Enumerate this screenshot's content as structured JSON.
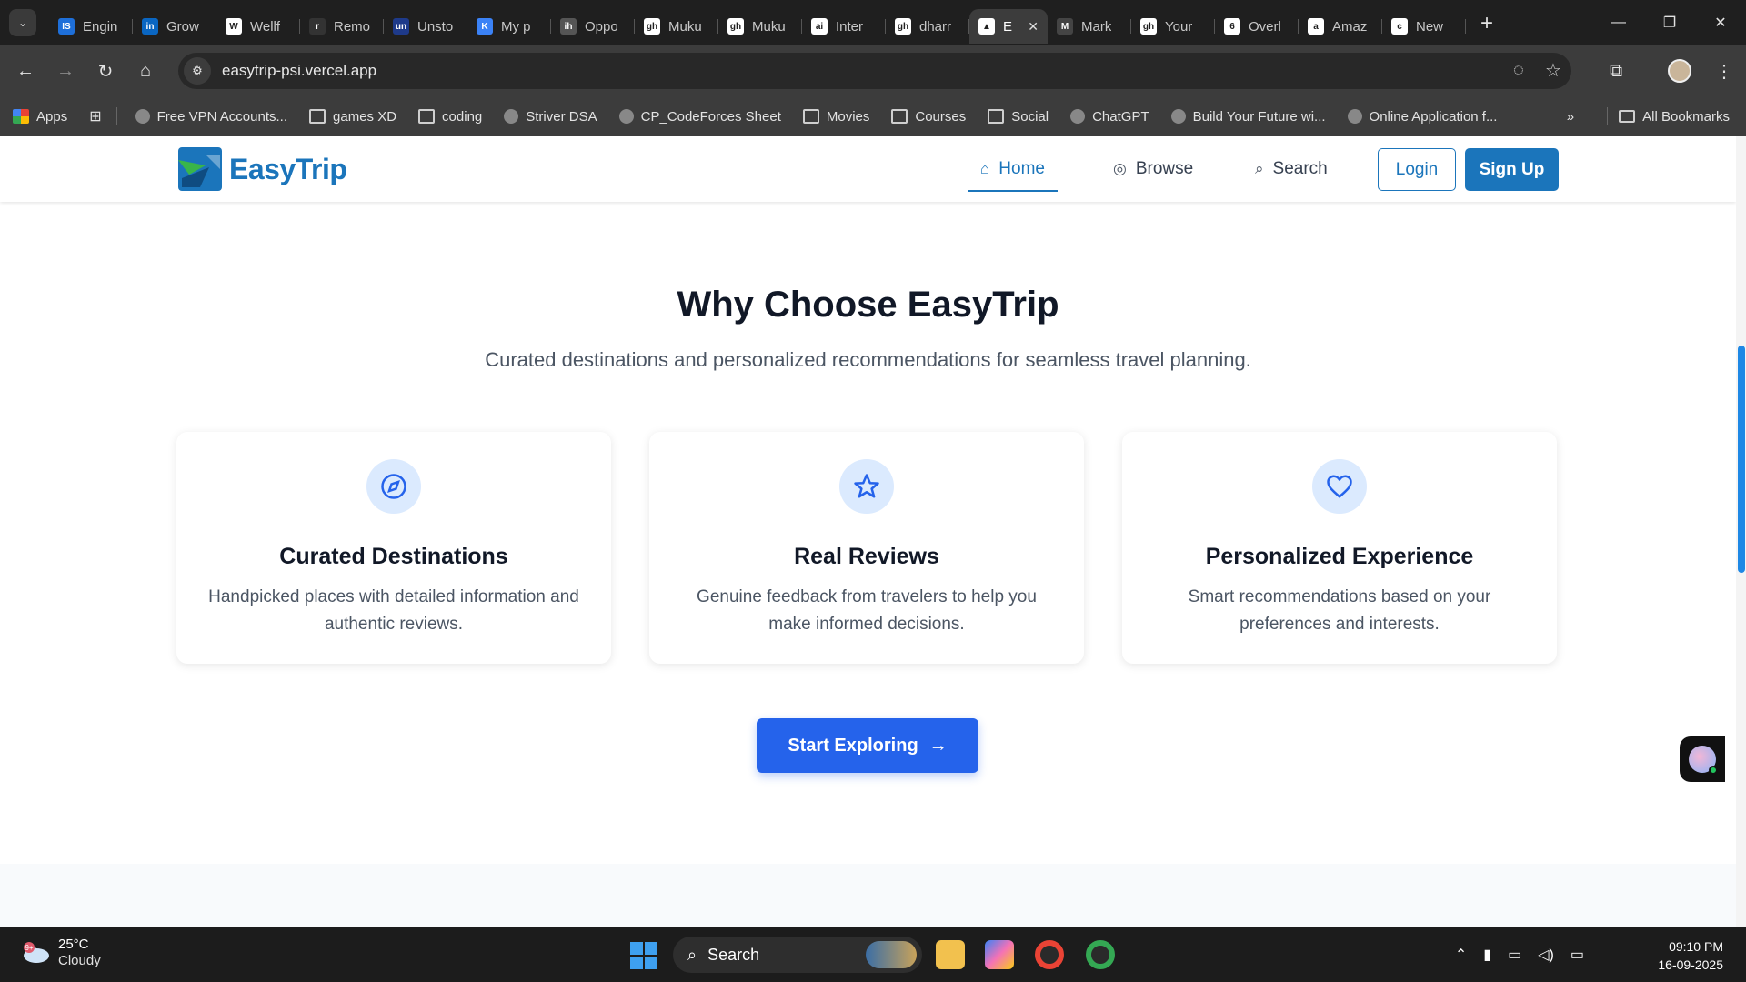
{
  "browser": {
    "tabs": [
      {
        "label": "Engin",
        "color": "#1e6fd9",
        "glyph": "IS"
      },
      {
        "label": "Grow",
        "color": "#0a66c2",
        "glyph": "in"
      },
      {
        "label": "Wellf",
        "color": "#ffffff",
        "glyph": "W"
      },
      {
        "label": "Remo",
        "color": "#333333",
        "glyph": "r"
      },
      {
        "label": "Unsto",
        "color": "#1e3a8a",
        "glyph": "un"
      },
      {
        "label": "My p",
        "color": "#3b82f6",
        "glyph": "K"
      },
      {
        "label": "Oppo",
        "color": "#555555",
        "glyph": "ih"
      },
      {
        "label": "Muku",
        "color": "#ffffff",
        "glyph": "gh"
      },
      {
        "label": "Muku",
        "color": "#ffffff",
        "glyph": "gh"
      },
      {
        "label": "Inter",
        "color": "#ffffff",
        "glyph": "ai"
      },
      {
        "label": "dharr",
        "color": "#ffffff",
        "glyph": "gh"
      },
      {
        "label": "E",
        "color": "#ffffff",
        "glyph": "▲",
        "active": true
      },
      {
        "label": "Mark",
        "color": "#444444",
        "glyph": "M"
      },
      {
        "label": "Your",
        "color": "#ffffff",
        "glyph": "gh"
      },
      {
        "label": "Overl",
        "color": "#ffffff",
        "glyph": "6"
      },
      {
        "label": "Amaz",
        "color": "#ffffff",
        "glyph": "a"
      },
      {
        "label": "New",
        "color": "#ffffff",
        "glyph": "c"
      }
    ],
    "url": "easytrip-psi.vercel.app",
    "bookmarks": [
      {
        "label": "Apps",
        "type": "apps"
      },
      {
        "label": "Free VPN Accounts...",
        "type": "site"
      },
      {
        "label": "games XD",
        "type": "folder"
      },
      {
        "label": "coding",
        "type": "folder"
      },
      {
        "label": "Striver DSA",
        "type": "site"
      },
      {
        "label": "CP_CodeForces Sheet",
        "type": "site"
      },
      {
        "label": "Movies",
        "type": "folder"
      },
      {
        "label": "Courses",
        "type": "folder"
      },
      {
        "label": "Social",
        "type": "folder"
      },
      {
        "label": "ChatGPT",
        "type": "site"
      },
      {
        "label": "Build Your Future wi...",
        "type": "site"
      },
      {
        "label": "Online Application f...",
        "type": "site"
      }
    ],
    "all_bookmarks": "All Bookmarks"
  },
  "site": {
    "brand": "EasyTrip",
    "nav": {
      "home": "Home",
      "browse": "Browse",
      "search": "Search"
    },
    "login": "Login",
    "signup": "Sign Up"
  },
  "section": {
    "title": "Why Choose EasyTrip",
    "subtitle": "Curated destinations and personalized recommendations for seamless travel planning.",
    "cards": [
      {
        "title": "Curated Destinations",
        "desc": "Handpicked places with detailed information and authentic reviews.",
        "icon": "compass-icon"
      },
      {
        "title": "Real Reviews",
        "desc": "Genuine feedback from travelers to help you make informed decisions.",
        "icon": "star-icon"
      },
      {
        "title": "Personalized Experience",
        "desc": "Smart recommendations based on your preferences and interests.",
        "icon": "heart-icon"
      }
    ],
    "cta": "Start Exploring"
  },
  "taskbar": {
    "weather_badge": "9+",
    "temp": "25°C",
    "condition": "Cloudy",
    "search": "Search",
    "time": "09:10 PM",
    "date": "16-09-2025"
  },
  "colors": {
    "brand": "#1b75bb",
    "cta": "#2563eb",
    "icon_bg": "#dbeafe"
  }
}
